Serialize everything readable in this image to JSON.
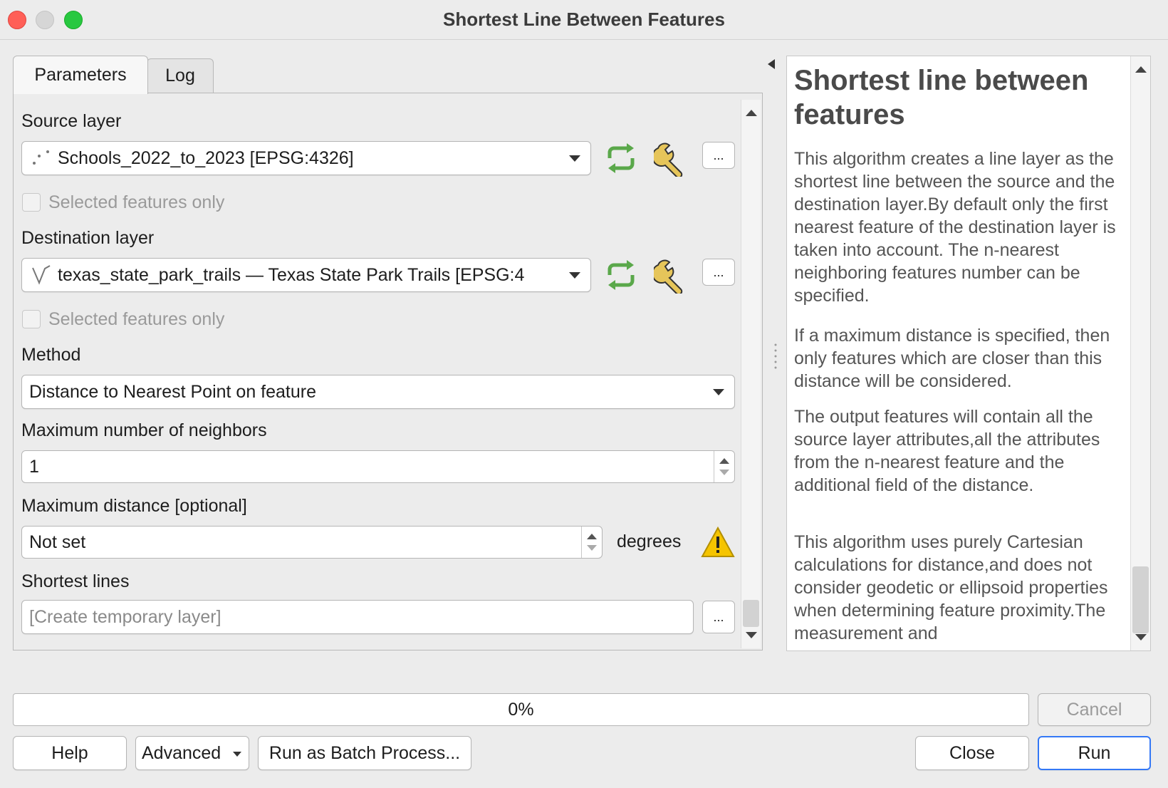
{
  "window": {
    "title": "Shortest Line Between Features"
  },
  "tabs": [
    {
      "label": "Parameters",
      "active": true
    },
    {
      "label": "Log",
      "active": false
    }
  ],
  "params": {
    "source_layer": {
      "label": "Source layer",
      "value": "Schools_2022_to_2023 [EPSG:4326]",
      "selected_only": "Selected features only"
    },
    "destination_layer": {
      "label": "Destination layer",
      "value": "texas_state_park_trails — Texas State Park Trails [EPSG:4",
      "selected_only": "Selected features only"
    },
    "method": {
      "label": "Method",
      "value": "Distance to Nearest Point on feature"
    },
    "max_neighbors": {
      "label": "Maximum number of neighbors",
      "value": "1"
    },
    "max_distance": {
      "label": "Maximum distance [optional]",
      "value": "Not set",
      "unit": "degrees"
    },
    "shortest_lines": {
      "label": "Shortest lines",
      "placeholder": "[Create temporary layer]"
    },
    "more_button": "..."
  },
  "help": {
    "title": "Shortest line between features",
    "paragraphs": [
      "This algorithm creates a line layer as the shortest line between the source and the destination layer.By default only the first nearest feature of the destination layer is taken into account. The n-nearest neighboring features number can be specified.",
      "If a maximum distance is specified, then only features which are closer than this distance will be considered.",
      "The output features will contain all the source layer attributes,all the attributes from the n-nearest feature and the additional field of the distance.",
      "This algorithm uses purely Cartesian calculations for distance,and does not consider geodetic or ellipsoid properties when determining feature proximity.The measurement and"
    ]
  },
  "progress": {
    "label": "0%",
    "value": 0
  },
  "buttons": {
    "cancel": "Cancel",
    "help": "Help",
    "advanced": "Advanced",
    "batch": "Run as Batch Process...",
    "close": "Close",
    "run": "Run"
  },
  "colors": {
    "accent": "#3478f6",
    "warning": "#f5c400",
    "refresh_icon": "#5aa84a"
  }
}
